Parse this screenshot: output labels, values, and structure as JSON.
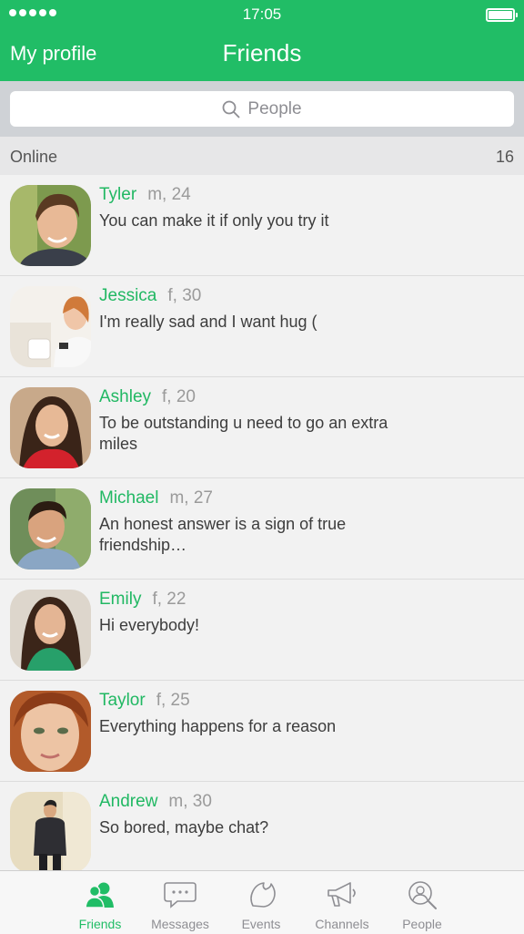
{
  "status": {
    "time": "17:05"
  },
  "nav": {
    "left_label": "My profile",
    "title": "Friends"
  },
  "search": {
    "placeholder": "People"
  },
  "section": {
    "label": "Online",
    "count": "16"
  },
  "friends": [
    {
      "name": "Tyler",
      "meta": "m, 24",
      "message": "You can make it if only you try it"
    },
    {
      "name": "Jessica",
      "meta": "f, 30",
      "message": "I'm really sad and I want hug ("
    },
    {
      "name": "Ashley",
      "meta": "f, 20",
      "message": "To be outstanding u need to go an extra miles"
    },
    {
      "name": "Michael",
      "meta": "m, 27",
      "message": "An honest answer is a sign of true friendship…"
    },
    {
      "name": "Emily",
      "meta": "f, 22",
      "message": "Hi everybody!"
    },
    {
      "name": "Taylor",
      "meta": "f, 25",
      "message": "Everything happens for a reason"
    },
    {
      "name": "Andrew",
      "meta": "m, 30",
      "message": "So bored, maybe chat?"
    }
  ],
  "tabs": [
    {
      "label": "Friends",
      "icon": "friends-icon",
      "active": true
    },
    {
      "label": "Messages",
      "icon": "messages-icon",
      "active": false
    },
    {
      "label": "Events",
      "icon": "events-icon",
      "active": false
    },
    {
      "label": "Channels",
      "icon": "channels-icon",
      "active": false
    },
    {
      "label": "People",
      "icon": "people-search-icon",
      "active": false
    }
  ],
  "colors": {
    "accent": "#21bd66",
    "name": "#21b863",
    "meta": "#9a9a9a",
    "tab_inactive": "#8e8e93"
  }
}
